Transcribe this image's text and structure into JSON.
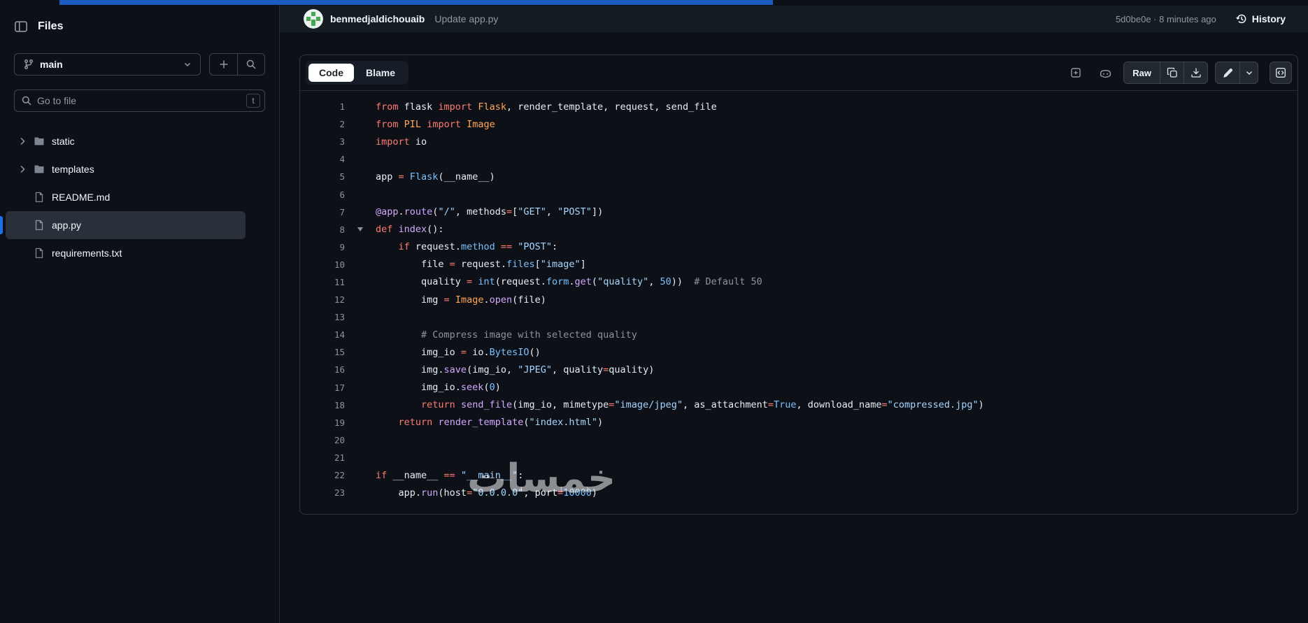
{
  "watermark": {
    "text": "خمسات"
  },
  "accents": {
    "blue_strip": "#1d5cbf",
    "accent_blue": "#1f6feb",
    "selected_row": "#2a303a"
  },
  "sidebar": {
    "title": "Files",
    "branch": {
      "name": "main"
    },
    "goto_file": {
      "placeholder": "Go to file",
      "shortcut_key": "t"
    },
    "tree": [
      {
        "type": "folder",
        "label": "static",
        "selected": false
      },
      {
        "type": "folder",
        "label": "templates",
        "selected": false
      },
      {
        "type": "file",
        "label": "README.md",
        "selected": false
      },
      {
        "type": "file",
        "label": "app.py",
        "selected": true
      },
      {
        "type": "file",
        "label": "requirements.txt",
        "selected": false
      }
    ]
  },
  "commit_bar": {
    "author": "benmedjaldichouaib",
    "message": "Update app.py",
    "sha_time": "5d0be0e · 8 minutes ago",
    "history_label": "History"
  },
  "toolbar": {
    "tabs": [
      {
        "label": "Code",
        "active": true
      },
      {
        "label": "Blame",
        "active": false
      }
    ],
    "raw_label": "Raw"
  },
  "code": {
    "language": "python",
    "fold_lines": [
      8
    ],
    "lines": [
      [
        [
          "k",
          "from"
        ],
        [
          "p",
          " flask "
        ],
        [
          "k",
          "import"
        ],
        [
          "p",
          " "
        ],
        [
          "cl",
          "Flask"
        ],
        [
          "p",
          ", render_template, request, send_file"
        ]
      ],
      [
        [
          "k",
          "from"
        ],
        [
          "p",
          " "
        ],
        [
          "cl",
          "PIL"
        ],
        [
          "p",
          " "
        ],
        [
          "k",
          "import"
        ],
        [
          "p",
          " "
        ],
        [
          "cl",
          "Image"
        ]
      ],
      [
        [
          "k",
          "import"
        ],
        [
          "p",
          " io"
        ]
      ],
      [],
      [
        [
          "p",
          "app "
        ],
        [
          "k",
          "="
        ],
        [
          "p",
          " "
        ],
        [
          "n",
          "Flask"
        ],
        [
          "p",
          "(__name__)"
        ]
      ],
      [],
      [
        [
          "f",
          "@app"
        ],
        [
          "p",
          "."
        ],
        [
          "f",
          "route"
        ],
        [
          "p",
          "("
        ],
        [
          "s",
          "\"/\""
        ],
        [
          "p",
          ", methods"
        ],
        [
          "k",
          "="
        ],
        [
          "p",
          "["
        ],
        [
          "s",
          "\"GET\""
        ],
        [
          "p",
          ", "
        ],
        [
          "s",
          "\"POST\""
        ],
        [
          "p",
          "])"
        ]
      ],
      [
        [
          "k",
          "def"
        ],
        [
          "p",
          " "
        ],
        [
          "f",
          "index"
        ],
        [
          "p",
          "():"
        ]
      ],
      [
        [
          "p",
          "    "
        ],
        [
          "k",
          "if"
        ],
        [
          "p",
          " request."
        ],
        [
          "n",
          "method"
        ],
        [
          "p",
          " "
        ],
        [
          "k",
          "=="
        ],
        [
          "p",
          " "
        ],
        [
          "s",
          "\"POST\""
        ],
        [
          "p",
          ":"
        ]
      ],
      [
        [
          "p",
          "        file "
        ],
        [
          "k",
          "="
        ],
        [
          "p",
          " request."
        ],
        [
          "n",
          "files"
        ],
        [
          "p",
          "["
        ],
        [
          "s",
          "\"image\""
        ],
        [
          "p",
          "]"
        ]
      ],
      [
        [
          "p",
          "        quality "
        ],
        [
          "k",
          "="
        ],
        [
          "p",
          " "
        ],
        [
          "n",
          "int"
        ],
        [
          "p",
          "(request."
        ],
        [
          "n",
          "form"
        ],
        [
          "p",
          "."
        ],
        [
          "f",
          "get"
        ],
        [
          "p",
          "("
        ],
        [
          "s",
          "\"quality\""
        ],
        [
          "p",
          ", "
        ],
        [
          "n",
          "50"
        ],
        [
          "p",
          "))  "
        ],
        [
          "c",
          "# Default 50"
        ]
      ],
      [
        [
          "p",
          "        img "
        ],
        [
          "k",
          "="
        ],
        [
          "p",
          " "
        ],
        [
          "cl",
          "Image"
        ],
        [
          "p",
          "."
        ],
        [
          "f",
          "open"
        ],
        [
          "p",
          "(file)"
        ]
      ],
      [],
      [
        [
          "p",
          "        "
        ],
        [
          "c",
          "# Compress image with selected quality"
        ]
      ],
      [
        [
          "p",
          "        img_io "
        ],
        [
          "k",
          "="
        ],
        [
          "p",
          " io."
        ],
        [
          "n",
          "BytesIO"
        ],
        [
          "p",
          "()"
        ]
      ],
      [
        [
          "p",
          "        img."
        ],
        [
          "f",
          "save"
        ],
        [
          "p",
          "(img_io, "
        ],
        [
          "s",
          "\"JPEG\""
        ],
        [
          "p",
          ", quality"
        ],
        [
          "k",
          "="
        ],
        [
          "p",
          "quality)"
        ]
      ],
      [
        [
          "p",
          "        img_io."
        ],
        [
          "f",
          "seek"
        ],
        [
          "p",
          "("
        ],
        [
          "n",
          "0"
        ],
        [
          "p",
          ")"
        ]
      ],
      [
        [
          "p",
          "        "
        ],
        [
          "k",
          "return"
        ],
        [
          "p",
          " "
        ],
        [
          "f",
          "send_file"
        ],
        [
          "p",
          "(img_io, mimetype"
        ],
        [
          "k",
          "="
        ],
        [
          "s",
          "\"image/jpeg\""
        ],
        [
          "p",
          ", as_attachment"
        ],
        [
          "k",
          "="
        ],
        [
          "n",
          "True"
        ],
        [
          "p",
          ", download_name"
        ],
        [
          "k",
          "="
        ],
        [
          "s",
          "\"compressed.jpg\""
        ],
        [
          "p",
          ")"
        ]
      ],
      [
        [
          "p",
          "    "
        ],
        [
          "k",
          "return"
        ],
        [
          "p",
          " "
        ],
        [
          "f",
          "render_template"
        ],
        [
          "p",
          "("
        ],
        [
          "s",
          "\"index.html\""
        ],
        [
          "p",
          ")"
        ]
      ],
      [],
      [],
      [
        [
          "k",
          "if"
        ],
        [
          "p",
          " __name__ "
        ],
        [
          "k",
          "=="
        ],
        [
          "p",
          " "
        ],
        [
          "s",
          "\"__main__\""
        ],
        [
          "p",
          ":"
        ]
      ],
      [
        [
          "p",
          "    app."
        ],
        [
          "f",
          "run"
        ],
        [
          "p",
          "(host"
        ],
        [
          "k",
          "="
        ],
        [
          "s",
          "\"0.0.0.0\""
        ],
        [
          "p",
          ", port"
        ],
        [
          "k",
          "="
        ],
        [
          "n",
          "10000"
        ],
        [
          "p",
          ")"
        ]
      ]
    ]
  }
}
